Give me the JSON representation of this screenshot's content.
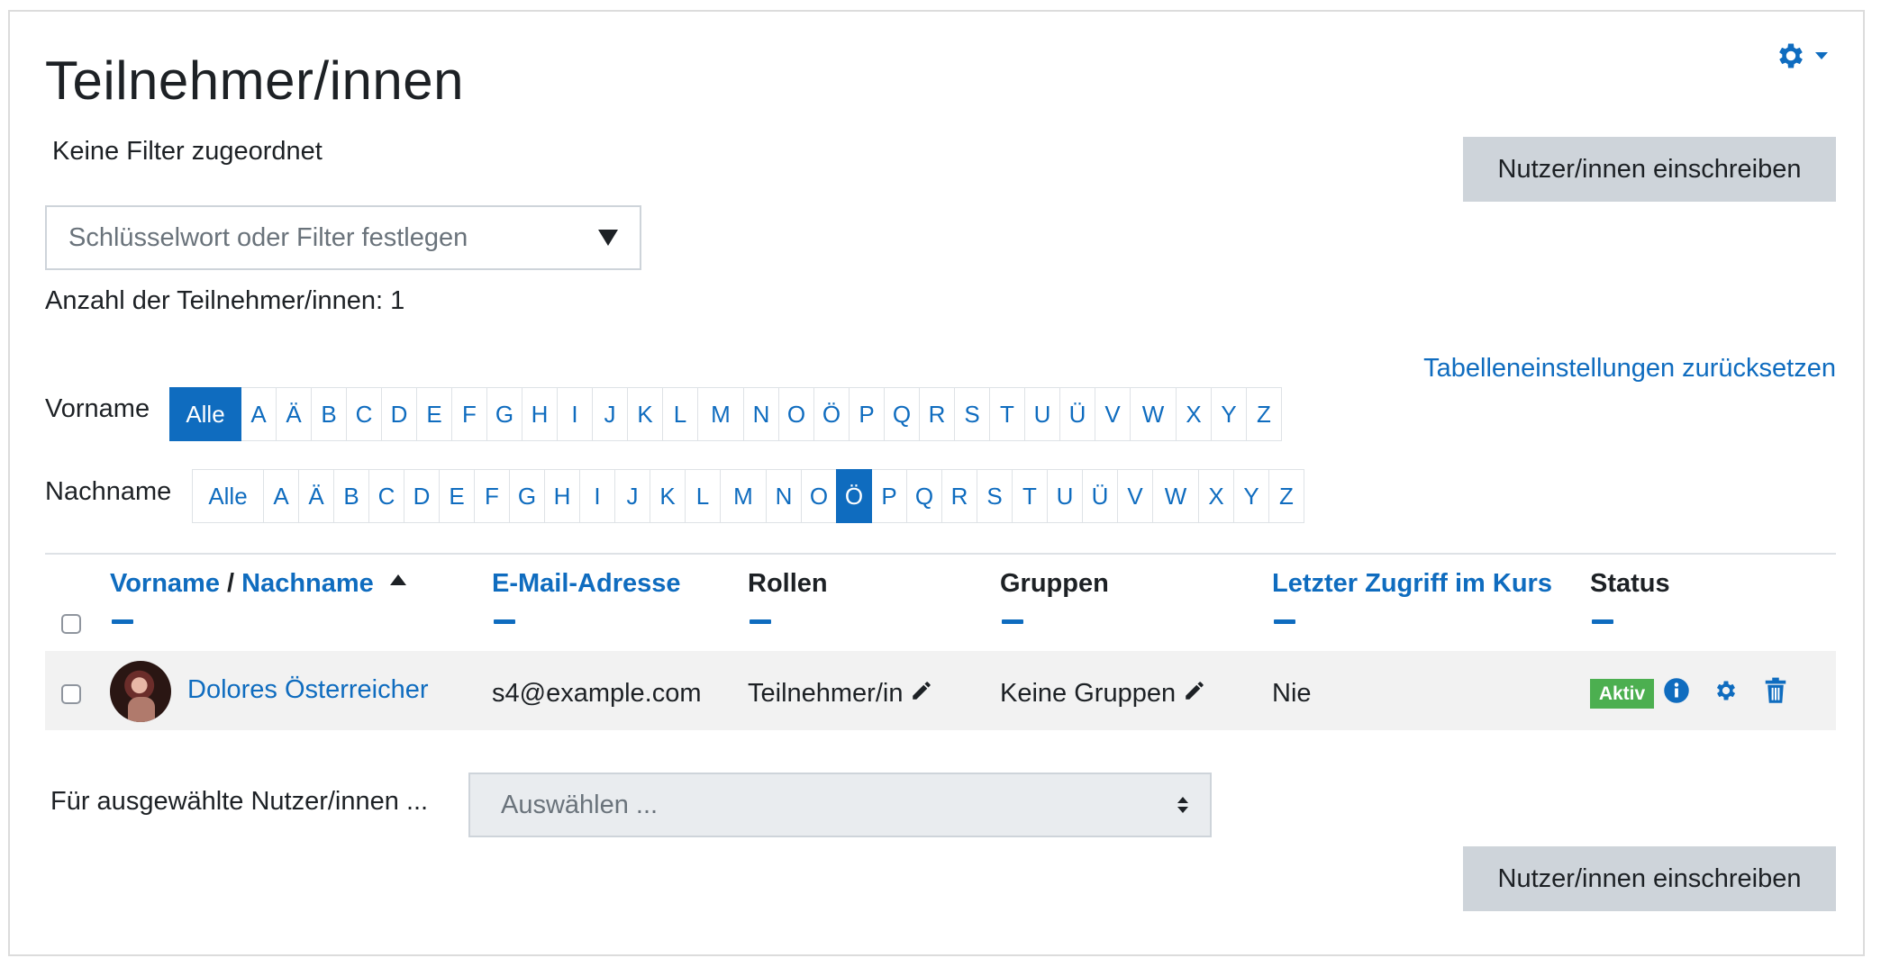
{
  "page": {
    "title": "Teilnehmer/innen",
    "no_filter_text": "Keine Filter zugeordnet",
    "enrol_button": "Nutzer/innen einschreiben",
    "filter_placeholder": "Schlüsselwort oder Filter festlegen",
    "participant_count": "Anzahl der Teilnehmer/innen: 1",
    "reset_table": "Tabelleneinstellungen zurücksetzen"
  },
  "initials": {
    "firstname_label": "Vorname",
    "lastname_label": "Nachname",
    "all_label": "Alle",
    "letters": [
      "A",
      "Ä",
      "B",
      "C",
      "D",
      "E",
      "F",
      "G",
      "H",
      "I",
      "J",
      "K",
      "L",
      "M",
      "N",
      "O",
      "Ö",
      "P",
      "Q",
      "R",
      "S",
      "T",
      "U",
      "Ü",
      "V",
      "W",
      "X",
      "Y",
      "Z"
    ],
    "firstname_selected": "Alle",
    "lastname_selected": "Ö"
  },
  "table": {
    "headers": {
      "firstname": "Vorname",
      "separator": "/",
      "lastname": "Nachname",
      "email": "E-Mail-Adresse",
      "roles": "Rollen",
      "groups": "Gruppen",
      "lastaccess": "Letzter Zugriff im Kurs",
      "status": "Status"
    },
    "rows": [
      {
        "name": "Dolores Österreicher",
        "email": "s4@example.com",
        "role": "Teilnehmer/in",
        "groups": "Keine Gruppen",
        "lastaccess": "Nie",
        "status": "Aktiv"
      }
    ]
  },
  "bulk": {
    "label": "Für ausgewählte Nutzer/innen ...",
    "select_placeholder": "Auswählen ..."
  },
  "colors": {
    "accent": "#0f6cbf",
    "status_active": "#4caf50",
    "button_grey": "#ced4da",
    "row_highlight": "#f2f2f2"
  },
  "icons": [
    "gear-icon",
    "caret-down-icon",
    "sort-asc-icon",
    "pencil-icon",
    "info-icon",
    "cog-icon",
    "trash-icon",
    "select-arrows-icon"
  ]
}
